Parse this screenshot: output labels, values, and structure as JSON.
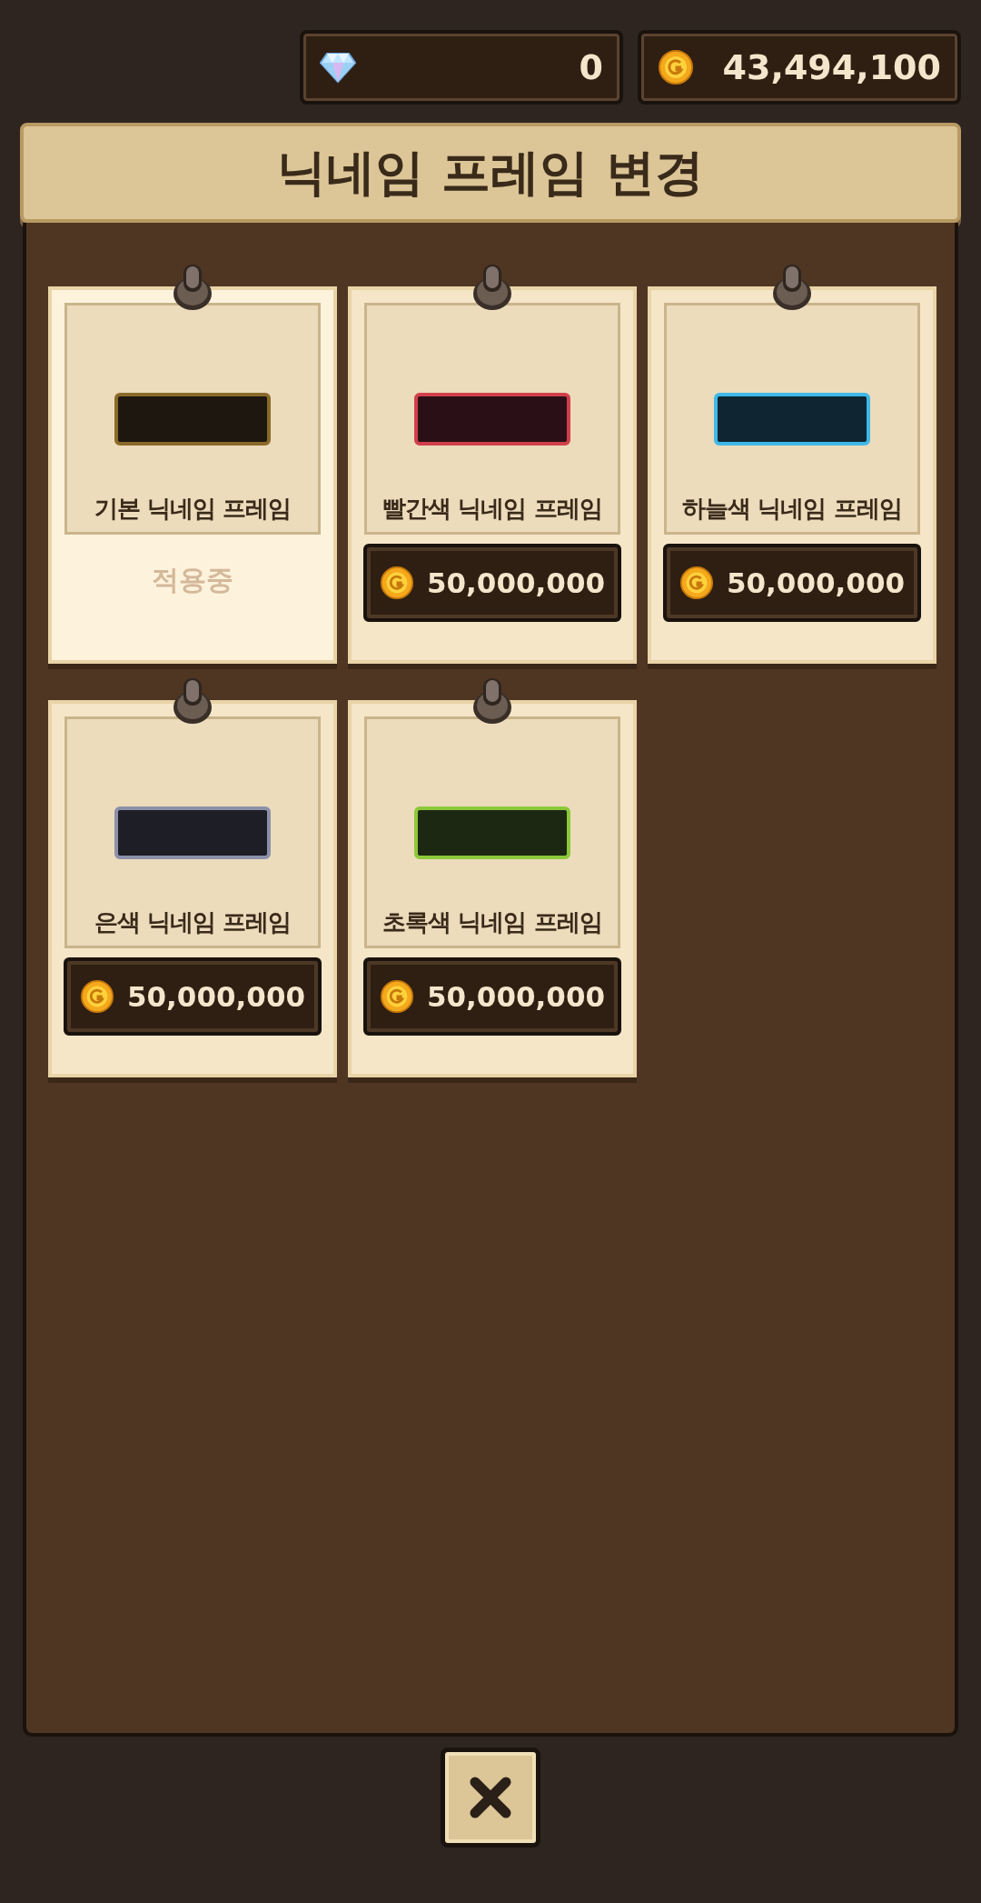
{
  "currency": {
    "gems": "0",
    "gold": "43,494,100"
  },
  "title": "닉네임 프레임 변경",
  "frames": [
    {
      "name": "기본 닉네임 프레임",
      "color": "#8a6a2a",
      "applied": true,
      "status": "적용중"
    },
    {
      "name": "빨간색 닉네임 프레임",
      "color": "#d0404a",
      "applied": false,
      "price": "50,000,000"
    },
    {
      "name": "하늘색 닉네임 프레임",
      "color": "#3fb8e8",
      "applied": false,
      "price": "50,000,000"
    },
    {
      "name": "은색 닉네임 프레임",
      "color": "#8c90a8",
      "applied": false,
      "price": "50,000,000"
    },
    {
      "name": "초록색 닉네임 프레임",
      "color": "#8cc83a",
      "applied": false,
      "price": "50,000,000"
    }
  ]
}
